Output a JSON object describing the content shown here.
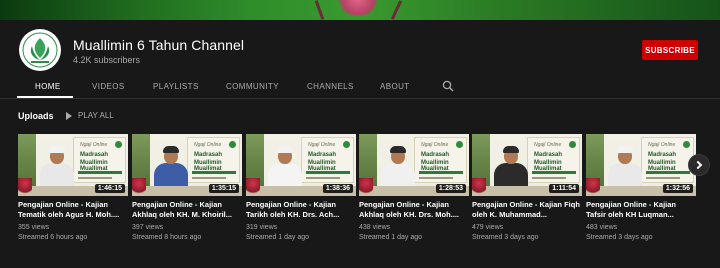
{
  "channel": {
    "title": "Muallimin 6 Tahun Channel",
    "subscribers": "4.2K subscribers",
    "subscribe_label": "SUBSCRIBE",
    "avatar_icon": "muallimin-logo-icon"
  },
  "tabs": [
    {
      "label": "HOME",
      "active": true
    },
    {
      "label": "VIDEOS",
      "active": false
    },
    {
      "label": "PLAYLISTS",
      "active": false
    },
    {
      "label": "COMMUNITY",
      "active": false
    },
    {
      "label": "CHANNELS",
      "active": false
    },
    {
      "label": "ABOUT",
      "active": false
    }
  ],
  "section": {
    "title": "Uploads",
    "play_all": "PLAY ALL"
  },
  "videos": [
    {
      "title": "Pengajian Online - Kajian Tematik oleh Agus H. Moh....",
      "duration": "1:46:15",
      "views": "355 views",
      "streamed": "Streamed 6 hours ago"
    },
    {
      "title": "Pengajian Online - Kajian Akhlaq oleh KH. M. Khoiril...",
      "duration": "1:35:15",
      "views": "397 views",
      "streamed": "Streamed 8 hours ago"
    },
    {
      "title": "Pengajian Online - Kajian Tarikh oleh KH. Drs. Ach...",
      "duration": "1:38:36",
      "views": "319 views",
      "streamed": "Streamed 1 day ago"
    },
    {
      "title": "Pengajian Online - Kajian Akhlaq oleh KH. Drs. Moh....",
      "duration": "1:28:53",
      "views": "438 views",
      "streamed": "Streamed 1 day ago"
    },
    {
      "title": "Pengajian Online - Kajian Fiqh oleh K. Muhammad...",
      "duration": "1:11:54",
      "views": "479 views",
      "streamed": "Streamed 3 days ago"
    },
    {
      "title": "Pengajian Online - Kajian Tafsir oleh KH Luqman...",
      "duration": "1:32:56",
      "views": "483 views",
      "streamed": "Streamed 3 days ago"
    }
  ],
  "poster": {
    "line1": "Ngaji Online",
    "line2": "Madrasah",
    "line3": "Muallimin Muallimat"
  },
  "colors": {
    "subscribe": "#cc0000",
    "background": "#181818",
    "meta_text": "#aaaaaa"
  }
}
